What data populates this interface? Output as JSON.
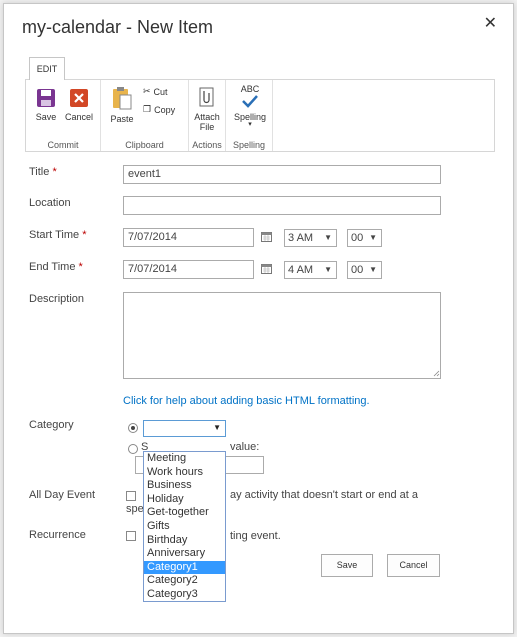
{
  "dialog": {
    "title": "my-calendar - New Item"
  },
  "ribbon": {
    "tab": "EDIT",
    "groups": {
      "commit": {
        "label": "Commit",
        "save": "Save",
        "cancel": "Cancel"
      },
      "clipboard": {
        "label": "Clipboard",
        "paste": "Paste",
        "cut": "Cut",
        "copy": "Copy"
      },
      "actions": {
        "label": "Actions",
        "attach_line1": "Attach",
        "attach_line2": "File"
      },
      "spelling": {
        "label": "Spelling",
        "spelling": "Spelling",
        "abc": "ABC"
      }
    }
  },
  "form": {
    "title": {
      "label": "Title",
      "value": "event1"
    },
    "location": {
      "label": "Location",
      "value": ""
    },
    "start_time": {
      "label": "Start Time",
      "date": "7/07/2014",
      "hour": "3 AM",
      "minute": "00"
    },
    "end_time": {
      "label": "End Time",
      "date": "7/07/2014",
      "hour": "4 AM",
      "minute": "00"
    },
    "description": {
      "label": "Description",
      "value": ""
    },
    "html_help_link": "Click for help about adding basic HTML formatting.",
    "category": {
      "label": "Category",
      "selected": "",
      "custom_prefix": "S",
      "custom_suffix": "value:",
      "options": [
        "Meeting",
        "Work hours",
        "Business",
        "Holiday",
        "Get-together",
        "Gifts",
        "Birthday",
        "Anniversary",
        "Category1",
        "Category2",
        "Category3"
      ],
      "highlighted": "Category1"
    },
    "all_day": {
      "label": "All Day Event",
      "text_line1": "ay activity that doesn't start or end at a",
      "text_line2": "spe"
    },
    "recurrence": {
      "label": "Recurrence",
      "text": "ting event."
    },
    "required_mark": "*"
  },
  "buttons": {
    "save": "Save",
    "cancel": "Cancel"
  },
  "colors": {
    "accent": "#0072c6",
    "save_icon": "#7a3591",
    "cancel_icon": "#d24726",
    "selection": "#3399ff"
  }
}
